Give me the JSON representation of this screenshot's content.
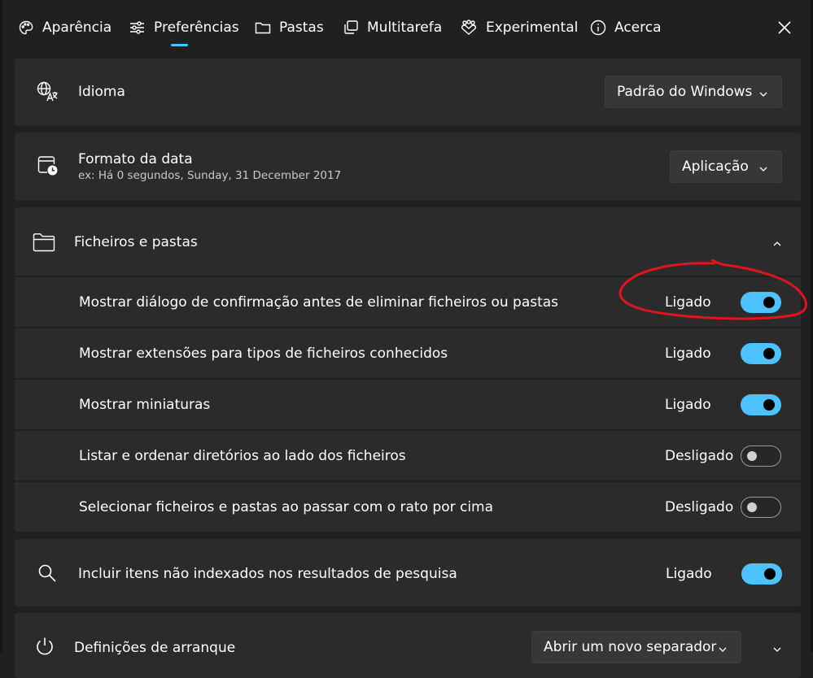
{
  "tabs": [
    {
      "label": "Aparência",
      "icon": "palette-icon"
    },
    {
      "label": "Preferências",
      "icon": "sliders-icon",
      "selected": true
    },
    {
      "label": "Pastas",
      "icon": "folder-icon"
    },
    {
      "label": "Multitarefa",
      "icon": "multitask-icon"
    },
    {
      "label": "Experimental",
      "icon": "experimental-icon"
    },
    {
      "label": "Acerca",
      "icon": "info-icon"
    }
  ],
  "language": {
    "label": "Idioma",
    "value": "Padrão do Windows"
  },
  "date_format": {
    "label": "Formato da data",
    "example": "ex: Há 0 segundos, Sunday, 31 December 2017",
    "value": "Aplicação"
  },
  "files_folders": {
    "label": "Ficheiros e pastas",
    "expanded": true,
    "items": [
      {
        "label": "Mostrar diálogo de confirmação antes de eliminar ficheiros ou pastas",
        "state": "Ligado",
        "on": true
      },
      {
        "label": "Mostrar extensões para tipos de ficheiros conhecidos",
        "state": "Ligado",
        "on": true
      },
      {
        "label": "Mostrar miniaturas",
        "state": "Ligado",
        "on": true
      },
      {
        "label": "Listar e ordenar diretórios ao lado dos ficheiros",
        "state": "Desligado",
        "on": false
      },
      {
        "label": "Selecionar ficheiros e pastas ao passar com o rato por cima",
        "state": "Desligado",
        "on": false
      }
    ]
  },
  "search": {
    "label": "Incluir itens não indexados nos resultados de pesquisa",
    "state": "Ligado",
    "on": true
  },
  "startup": {
    "label": "Definições de arranque",
    "value": "Abrir um novo separador"
  },
  "colors": {
    "accent": "#4cc2ff",
    "background": "#202020",
    "card": "#2b2b2b",
    "annotation": "#e0141e"
  }
}
